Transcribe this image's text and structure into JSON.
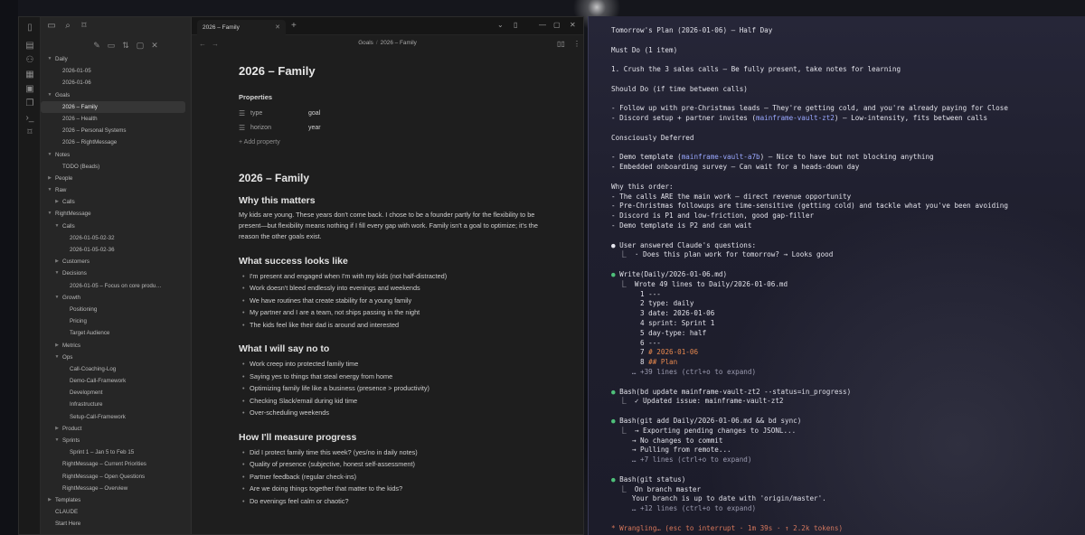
{
  "obsidian": {
    "tab_title": "2026 – Family",
    "breadcrumb": [
      "Goals",
      "2026 – Family"
    ],
    "tree": [
      {
        "label": "Daily",
        "depth": 0,
        "arrow": "down"
      },
      {
        "label": "2026-01-05",
        "depth": 1
      },
      {
        "label": "2026-01-06",
        "depth": 1
      },
      {
        "label": "Goals",
        "depth": 0,
        "arrow": "down"
      },
      {
        "label": "2026 – Family",
        "depth": 1,
        "active": true
      },
      {
        "label": "2026 – Health",
        "depth": 1
      },
      {
        "label": "2026 – Personal Systems",
        "depth": 1
      },
      {
        "label": "2026 – RightMessage",
        "depth": 1
      },
      {
        "label": "Notes",
        "depth": 0,
        "arrow": "down"
      },
      {
        "label": "TODO (Beads)",
        "depth": 1
      },
      {
        "label": "People",
        "depth": 0,
        "arrow": "right"
      },
      {
        "label": "Raw",
        "depth": 0,
        "arrow": "down"
      },
      {
        "label": "Calls",
        "depth": 1,
        "arrow": "right"
      },
      {
        "label": "RightMessage",
        "depth": 0,
        "arrow": "down"
      },
      {
        "label": "Calls",
        "depth": 1,
        "arrow": "down"
      },
      {
        "label": "2026-01-05-02-32",
        "depth": 2
      },
      {
        "label": "2026-01-05-02-36",
        "depth": 2
      },
      {
        "label": "Customers",
        "depth": 1,
        "arrow": "right"
      },
      {
        "label": "Decisions",
        "depth": 1,
        "arrow": "down"
      },
      {
        "label": "2026-01-05 – Focus on core produ…",
        "depth": 2
      },
      {
        "label": "Growth",
        "depth": 1,
        "arrow": "down"
      },
      {
        "label": "Positioning",
        "depth": 2
      },
      {
        "label": "Pricing",
        "depth": 2
      },
      {
        "label": "Target Audience",
        "depth": 2
      },
      {
        "label": "Metrics",
        "depth": 1,
        "arrow": "right"
      },
      {
        "label": "Ops",
        "depth": 1,
        "arrow": "down"
      },
      {
        "label": "Call-Coaching-Log",
        "depth": 2
      },
      {
        "label": "Demo-Call-Framework",
        "depth": 2
      },
      {
        "label": "Development",
        "depth": 2
      },
      {
        "label": "Infrastructure",
        "depth": 2
      },
      {
        "label": "Setup-Call-Framework",
        "depth": 2
      },
      {
        "label": "Product",
        "depth": 1,
        "arrow": "right"
      },
      {
        "label": "Sprints",
        "depth": 1,
        "arrow": "down"
      },
      {
        "label": "Sprint 1 – Jan 5 to Feb 15",
        "depth": 2
      },
      {
        "label": "RightMessage – Current Priorities",
        "depth": 1
      },
      {
        "label": "RightMessage – Open Questions",
        "depth": 1
      },
      {
        "label": "RightMessage – Overview",
        "depth": 1
      },
      {
        "label": "Templates",
        "depth": 0,
        "arrow": "right"
      },
      {
        "label": "CLAUDE",
        "depth": 0
      },
      {
        "label": "Start Here",
        "depth": 0
      }
    ],
    "note": {
      "title": "2026 – Family",
      "properties_heading": "Properties",
      "properties": [
        {
          "key": "type",
          "value": "goal"
        },
        {
          "key": "horizon",
          "value": "year"
        }
      ],
      "add_property": "Add property",
      "h1": "2026 – Family",
      "why_heading": "Why this matters",
      "why_text": "My kids are young. These years don't come back. I chose to be a founder partly for the flexibility to be present—but flexibility means nothing if I fill every gap with work. Family isn't a goal to optimize; it's the reason the other goals exist.",
      "success_heading": "What success looks like",
      "success_items": [
        "I'm present and engaged when I'm with my kids (not half-distracted)",
        "Work doesn't bleed endlessly into evenings and weekends",
        "We have routines that create stability for a young family",
        "My partner and I are a team, not ships passing in the night",
        "The kids feel like their dad is around and interested"
      ],
      "no_heading": "What I will say no to",
      "no_items": [
        "Work creep into protected family time",
        "Saying yes to things that steal energy from home",
        "Optimizing family life like a business (presence > productivity)",
        "Checking Slack/email during kid time",
        "Over-scheduling weekends"
      ],
      "measure_heading": "How I'll measure progress",
      "measure_items": [
        "Did I protect family time this week? (yes/no in daily notes)",
        "Quality of presence (subjective, honest self-assessment)",
        "Partner feedback (regular check-ins)",
        "Are we doing things together that matter to the kids?",
        "Do evenings feel calm or chaotic?"
      ]
    }
  },
  "terminal": {
    "lines": [
      {
        "text": "Tomorrow's Plan (2026-01-06) — Half Day"
      },
      {
        "text": ""
      },
      {
        "text": "Must Do (1 item)"
      },
      {
        "text": ""
      },
      {
        "text": "1. Crush the 3 sales calls — Be fully present, take notes for learning"
      },
      {
        "text": ""
      },
      {
        "text": "Should Do (if time between calls)"
      },
      {
        "text": ""
      },
      {
        "text": "- Follow up with pre-Christmas leads — They're getting cold, and you're already paying for Close"
      },
      {
        "text": "- Discord setup + partner invites (mainframe-vault-zt2) — Low-intensity, fits between calls"
      },
      {
        "text": ""
      },
      {
        "text": "Consciously Deferred"
      },
      {
        "text": ""
      },
      {
        "text": "- Demo template (mainframe-vault-a7b) — Nice to have but not blocking anything"
      },
      {
        "text": "- Embedded onboarding survey — Can wait for a heads-down day"
      },
      {
        "text": ""
      },
      {
        "text": "Why this order:"
      },
      {
        "text": "- The calls ARE the main work — direct revenue opportunity"
      },
      {
        "text": "- Pre-Christmas followups are time-sensitive (getting cold) and tackle what you've been avoiding"
      },
      {
        "text": "- Discord is P1 and low-friction, good gap-filler"
      },
      {
        "text": "- Demo template is P2 and can wait"
      },
      {
        "text": ""
      },
      {
        "text": "● User answered Claude's questions:"
      },
      {
        "text": "  ⎿  · Does this plan work for tomorrow? → Looks good"
      },
      {
        "text": ""
      },
      {
        "text": "● Write(Daily/2026-01-06.md)"
      },
      {
        "text": "  ⎿  Wrote 49 lines to Daily/2026-01-06.md"
      },
      {
        "text": "       1 ---"
      },
      {
        "text": "       2 type: daily"
      },
      {
        "text": "       3 date: 2026-01-06"
      },
      {
        "text": "       4 sprint: Sprint 1"
      },
      {
        "text": "       5 day-type: half"
      },
      {
        "text": "       6 ---"
      },
      {
        "text": "       7 # 2026-01-06"
      },
      {
        "text": "       8 ## Plan"
      },
      {
        "text": "     … +39 lines (ctrl+o to expand)"
      },
      {
        "text": ""
      },
      {
        "text": "● Bash(bd update mainframe-vault-zt2 --status=in_progress)"
      },
      {
        "text": "  ⎿  ✓ Updated issue: mainframe-vault-zt2"
      },
      {
        "text": ""
      },
      {
        "text": "● Bash(git add Daily/2026-01-06.md && bd sync)"
      },
      {
        "text": "  ⎿  → Exporting pending changes to JSONL..."
      },
      {
        "text": "     → No changes to commit"
      },
      {
        "text": "     → Pulling from remote..."
      },
      {
        "text": "     … +7 lines (ctrl+o to expand)"
      },
      {
        "text": ""
      },
      {
        "text": "● Bash(git status)"
      },
      {
        "text": "  ⎿  On branch master"
      },
      {
        "text": "     Your branch is up to date with 'origin/master'."
      },
      {
        "text": "     … +12 lines (ctrl+o to expand)"
      },
      {
        "text": ""
      },
      {
        "text": "* Wrangling… (esc to interrupt · 1m 39s · ↑ 2.2k tokens)"
      }
    ]
  }
}
